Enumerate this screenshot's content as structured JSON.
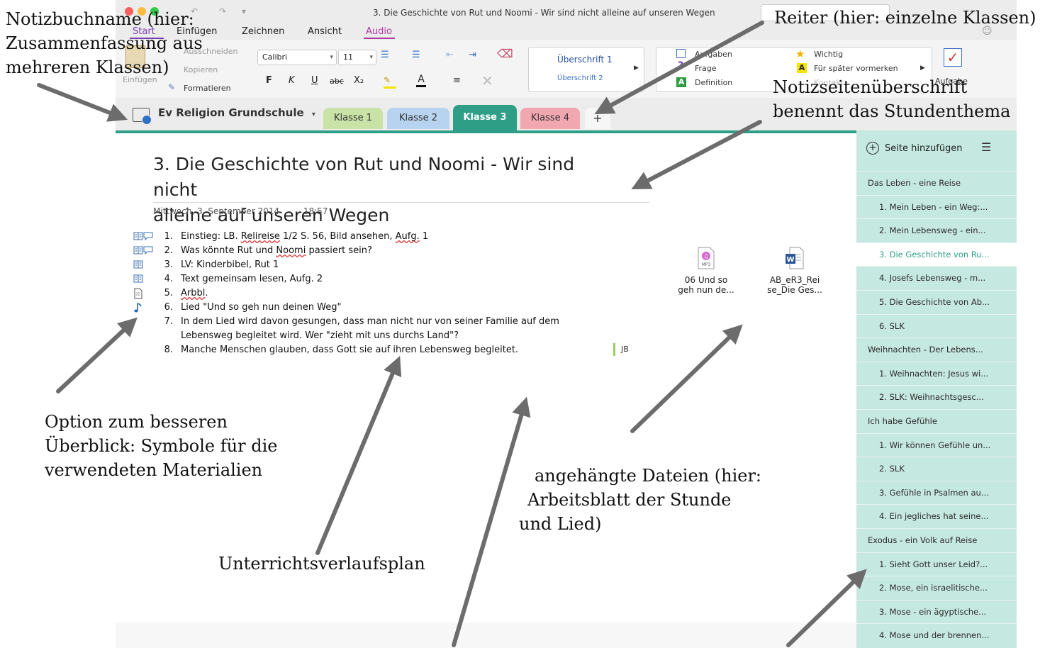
{
  "window": {
    "title": "3. Die Geschichte von Rut und Noomi - Wir sind nicht alleine auf unseren Wegen",
    "qa_undo": "↶",
    "qa_redo": "↷",
    "qa_more": "▾"
  },
  "ribbon_tabs": [
    "Start",
    "Einfügen",
    "Zeichnen",
    "Ansicht",
    "Audio"
  ],
  "ribbon": {
    "clipboard": {
      "cut": "Ausschneiden",
      "copy": "Kopieren",
      "format": "Formatieren",
      "paste": "Einfügen"
    },
    "font": {
      "name": "Calibri",
      "size": "11"
    },
    "format_buttons": {
      "bold": "F",
      "italic": "K",
      "underline": "U",
      "strike": "abc",
      "subscript": "X₂"
    },
    "styles": [
      "Überschrift 1",
      "Überschrift 2"
    ],
    "tags": {
      "todo": "Aufgaben",
      "question": "Frage",
      "definition": "Definition",
      "important": "Wichtig",
      "later": "Für später vormerken",
      "contact": "Kontakt"
    },
    "todo_button": "Aufgabe"
  },
  "notebook": {
    "name": "Ev Religion Grundschule"
  },
  "section_tabs": [
    {
      "label": "Klasse 1",
      "color": "#c9e3a6"
    },
    {
      "label": "Klasse 2",
      "color": "#b7d3ef"
    },
    {
      "label": "Klasse 3",
      "color": "#2e9e87"
    },
    {
      "label": "Klasse 4",
      "color": "#f1a7b0"
    }
  ],
  "add_tab_label": "+",
  "page": {
    "title_line1": "3. Die Geschichte von Rut und Noomi - Wir sind nicht",
    "title_line2": "alleine auf unseren Wegen",
    "date": "Mittwoch, 3. September 2014",
    "time": "18:57",
    "lesson_items": [
      {
        "num": "1.",
        "text": "Einstieg: LB. Relireise 1/2 S. 56, Bild ansehen, Aufg. 1",
        "icons": "book+speech"
      },
      {
        "num": "2.",
        "text": "Was könnte Rut und Noomi passiert sein?",
        "icons": "book+speech"
      },
      {
        "num": "3.",
        "text": "LV: Kinderbibel, Rut 1",
        "icons": "book"
      },
      {
        "num": "4.",
        "text": "Text gemeinsam lesen, Aufg. 2",
        "icons": "book"
      },
      {
        "num": "5.",
        "text": "Arbbl.",
        "icons": "sheet"
      },
      {
        "num": "6.",
        "text": "Lied \"Und so geh nun deinen Weg\"",
        "icons": "music"
      },
      {
        "num": "7.",
        "text": "In dem Lied wird davon gesungen, dass man nicht nur von seiner Familie auf dem",
        "icons": ""
      },
      {
        "num": "",
        "text": "Lebensweg begleitet wird. Wer \"zieht mit uns durchs Land\"?",
        "icons": ""
      },
      {
        "num": "8.",
        "text": "Manche Menschen glauben, dass Gott sie auf ihren Lebensweg begleitet.",
        "icons": ""
      }
    ],
    "author": "JB",
    "attachments": [
      {
        "line1": "06 Und so",
        "line2": "geh nun de...",
        "type": "MP3"
      },
      {
        "line1": "AB_eR3_Rei",
        "line2": "se_Die Ges...",
        "type": "W"
      }
    ]
  },
  "pages_panel": {
    "add_label": "Seite hinzufügen",
    "items": [
      {
        "label": "Das Leben - eine Reise",
        "level": "section"
      },
      {
        "label": "1. Mein Leben - ein Weg:...",
        "level": "sub"
      },
      {
        "label": "2. Mein Lebensweg - ein...",
        "level": "sub"
      },
      {
        "label": "3. Die Geschichte von Ru...",
        "level": "sub",
        "selected": true
      },
      {
        "label": "4. Josefs Lebensweg - m...",
        "level": "sub"
      },
      {
        "label": "5. Die Geschichte von Ab...",
        "level": "sub"
      },
      {
        "label": "6. SLK",
        "level": "sub"
      },
      {
        "label": "Weihnachten - Der Lebens...",
        "level": "section"
      },
      {
        "label": "1. Weihnachten: Jesus wi...",
        "level": "sub"
      },
      {
        "label": "2. SLK: Weihnachtsgesc...",
        "level": "sub"
      },
      {
        "label": "Ich habe Gefühle",
        "level": "section"
      },
      {
        "label": "1. Wir können Gefühle un...",
        "level": "sub"
      },
      {
        "label": "2. SLK",
        "level": "sub"
      },
      {
        "label": "3. Gefühle in Psalmen au...",
        "level": "sub"
      },
      {
        "label": "4. Ein jegliches hat seine...",
        "level": "sub"
      },
      {
        "label": "Exodus - ein Volk auf Reise",
        "level": "section"
      },
      {
        "label": "1. Sieht Gott unser Leid?...",
        "level": "sub"
      },
      {
        "label": "2. Mose, ein israelitische...",
        "level": "sub"
      },
      {
        "label": "3. Mose - ein ägyptische...",
        "level": "sub"
      },
      {
        "label": "4. Mose und der brennen...",
        "level": "sub"
      }
    ]
  },
  "annotations": {
    "notebook_name": [
      "Notizbuchname (hier:",
      "Zusammenfassung aus",
      "mehreren Klassen)"
    ],
    "tabs": [
      "Reiter (hier: einzelne Klassen)"
    ],
    "page_title": [
      "Notizseitenüberschrift",
      "benennt das Stundenthema"
    ],
    "symbols": [
      "Option zum besseren",
      "Überblick: Symbole für die",
      "verwendeten Materialien"
    ],
    "attachments": [
      "angehängte Dateien (hier:",
      "Arbeitsblatt der Stunde",
      "und Lied)"
    ],
    "lesson_plan": [
      "Unterrichtsverlaufsplan"
    ]
  }
}
